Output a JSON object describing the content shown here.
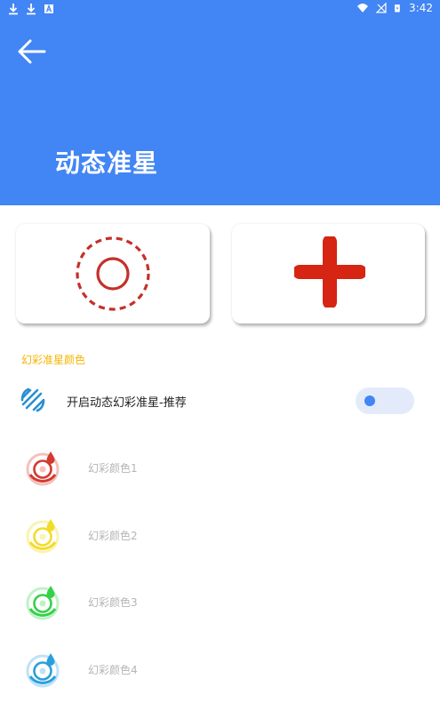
{
  "status_bar": {
    "time": "3:42",
    "left_icons": [
      "download-icon",
      "download-icon",
      "text-a-icon"
    ],
    "right_icons": [
      "wifi-icon",
      "no-signal-icon",
      "battery-charging-icon"
    ]
  },
  "header": {
    "title": "动态准星",
    "back_icon": "arrow-left-icon",
    "background_color": "#4285f4"
  },
  "crosshair_options": [
    {
      "name": "circle-dashed-crosshair",
      "color": "#c4302b"
    },
    {
      "name": "plus-crosshair",
      "color": "#d62513"
    }
  ],
  "section": {
    "title": "幻彩准星颜色",
    "title_color": "#f6b400"
  },
  "toggle": {
    "label": "开启动态幻彩准星-推荐",
    "icon": "rainbow-crosshair-icon",
    "enabled": false
  },
  "colors": [
    {
      "label": "幻彩颜色1",
      "color": "#d33a2f",
      "light": "#f4c1bd"
    },
    {
      "label": "幻彩颜色2",
      "color": "#f2dc2a",
      "light": "#fbf3b0"
    },
    {
      "label": "幻彩颜色3",
      "color": "#35d14a",
      "light": "#bff2c6"
    },
    {
      "label": "幻彩颜色4",
      "color": "#2b9fdc",
      "light": "#bfe2f6"
    }
  ]
}
